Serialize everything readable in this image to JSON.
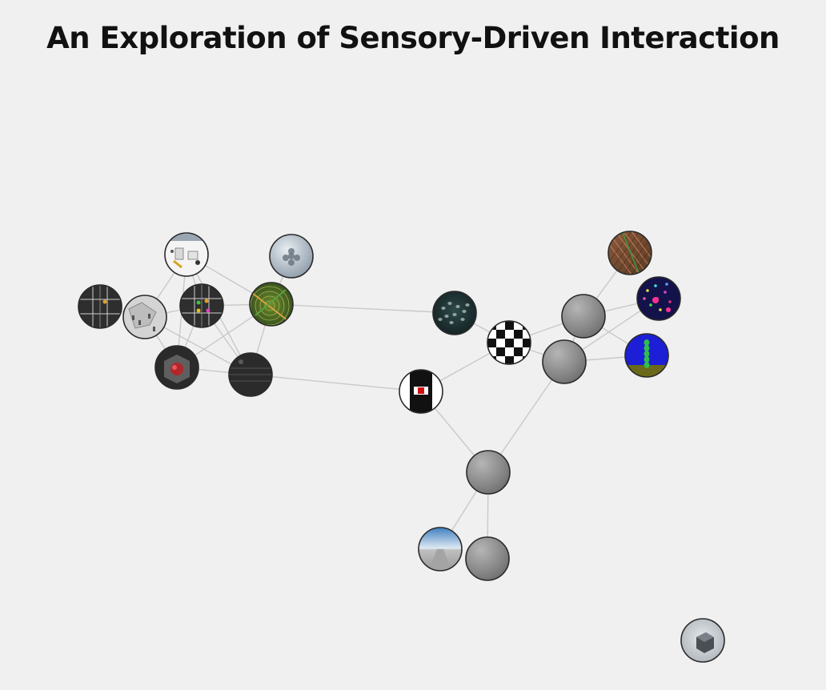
{
  "page": {
    "title": "An Exploration of Sensory-Driven Interaction"
  },
  "graph": {
    "nodes": [
      {
        "id": "n-lab-setup",
        "thumbnail": "lab-setup"
      },
      {
        "id": "n-metal-pattern",
        "thumbnail": "metal-pattern"
      },
      {
        "id": "n-dark-grid-1",
        "thumbnail": "dark-grid-dot"
      },
      {
        "id": "n-gray-sketch",
        "thumbnail": "gray-sketch"
      },
      {
        "id": "n-dark-grid-2",
        "thumbnail": "dark-grid-colored-dots"
      },
      {
        "id": "n-green-rings",
        "thumbnail": "green-rings"
      },
      {
        "id": "n-red-cube",
        "thumbnail": "red-cube"
      },
      {
        "id": "n-dark-stripes",
        "thumbnail": "dark-stripes"
      },
      {
        "id": "n-dark-teal-dots",
        "thumbnail": "teal-dots"
      },
      {
        "id": "n-checkerboard",
        "thumbnail": "checkerboard"
      },
      {
        "id": "n-red-square",
        "thumbnail": "red-square"
      },
      {
        "id": "n-gray-gradient-1",
        "thumbnail": "gray-gradient"
      },
      {
        "id": "n-gray-gradient-2",
        "thumbnail": "gray-gradient"
      },
      {
        "id": "n-brown-texture",
        "thumbnail": "brown-texture"
      },
      {
        "id": "n-purple-particles",
        "thumbnail": "purple-particles"
      },
      {
        "id": "n-blue-green-stem",
        "thumbnail": "blue-green-stem"
      },
      {
        "id": "n-gray-gradient-3",
        "thumbnail": "gray-gradient"
      },
      {
        "id": "n-sky-road",
        "thumbnail": "sky-road"
      },
      {
        "id": "n-gray-gradient-4",
        "thumbnail": "gray-gradient"
      },
      {
        "id": "n-white-cube",
        "thumbnail": "white-cube"
      }
    ],
    "edges": [
      [
        "n-lab-setup",
        "n-gray-sketch"
      ],
      [
        "n-lab-setup",
        "n-dark-grid-2"
      ],
      [
        "n-lab-setup",
        "n-green-rings"
      ],
      [
        "n-lab-setup",
        "n-dark-stripes"
      ],
      [
        "n-lab-setup",
        "n-red-cube"
      ],
      [
        "n-metal-pattern",
        "n-green-rings"
      ],
      [
        "n-dark-grid-1",
        "n-gray-sketch"
      ],
      [
        "n-gray-sketch",
        "n-dark-grid-2"
      ],
      [
        "n-gray-sketch",
        "n-red-cube"
      ],
      [
        "n-gray-sketch",
        "n-dark-stripes"
      ],
      [
        "n-dark-grid-2",
        "n-green-rings"
      ],
      [
        "n-dark-grid-2",
        "n-red-cube"
      ],
      [
        "n-dark-grid-2",
        "n-dark-stripes"
      ],
      [
        "n-green-rings",
        "n-red-cube"
      ],
      [
        "n-green-rings",
        "n-dark-stripes"
      ],
      [
        "n-green-rings",
        "n-dark-teal-dots"
      ],
      [
        "n-red-cube",
        "n-dark-stripes"
      ],
      [
        "n-dark-stripes",
        "n-red-square"
      ],
      [
        "n-dark-teal-dots",
        "n-checkerboard"
      ],
      [
        "n-checkerboard",
        "n-red-square"
      ],
      [
        "n-checkerboard",
        "n-gray-gradient-1"
      ],
      [
        "n-checkerboard",
        "n-gray-gradient-2"
      ],
      [
        "n-gray-gradient-1",
        "n-brown-texture"
      ],
      [
        "n-gray-gradient-1",
        "n-purple-particles"
      ],
      [
        "n-gray-gradient-1",
        "n-blue-green-stem"
      ],
      [
        "n-gray-gradient-1",
        "n-gray-gradient-2"
      ],
      [
        "n-gray-gradient-2",
        "n-blue-green-stem"
      ],
      [
        "n-gray-gradient-2",
        "n-purple-particles"
      ],
      [
        "n-gray-gradient-2",
        "n-gray-gradient-3"
      ],
      [
        "n-red-square",
        "n-gray-gradient-3"
      ],
      [
        "n-gray-gradient-3",
        "n-sky-road"
      ],
      [
        "n-gray-gradient-3",
        "n-gray-gradient-4"
      ]
    ]
  }
}
